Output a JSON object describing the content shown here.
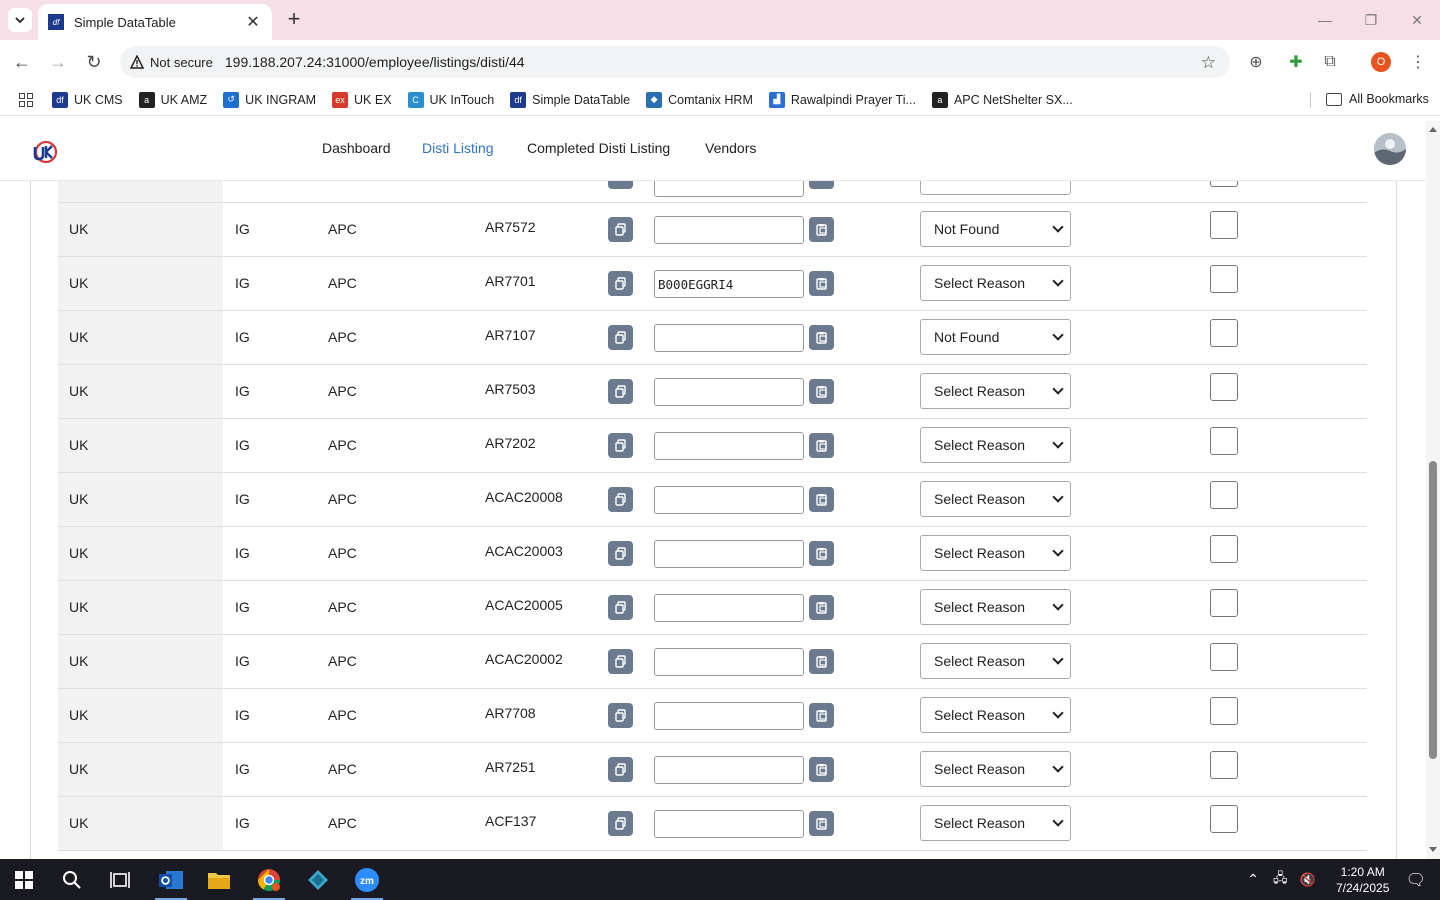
{
  "browser": {
    "tab_title": "Simple DataTable",
    "tab_favicon": "df",
    "security_label": "Not secure",
    "url": "199.188.207.24:31000/employee/listings/disti/44",
    "profile_initial": "O"
  },
  "bookmarks": [
    {
      "label": "UK CMS",
      "icon": "df",
      "color": "#1c3b8f"
    },
    {
      "label": "UK AMZ",
      "icon": "a",
      "color": "#222222"
    },
    {
      "label": "UK INGRAM",
      "icon": "↺",
      "color": "#1f6fd1"
    },
    {
      "label": "UK EX",
      "icon": "ex",
      "color": "#d83a2a"
    },
    {
      "label": "UK InTouch",
      "icon": "C",
      "color": "#2a8fd1"
    },
    {
      "label": "Simple DataTable",
      "icon": "df",
      "color": "#1c3b8f"
    },
    {
      "label": "Comtanix HRM",
      "icon": "◆",
      "color": "#2a6fb0"
    },
    {
      "label": "Rawalpindi Prayer Ti...",
      "icon": "▟",
      "color": "#2a6fd1"
    },
    {
      "label": "APC NetShelter SX...",
      "icon": "a",
      "color": "#222222"
    }
  ],
  "all_bookmarks_label": "All Bookmarks",
  "nav": {
    "links": [
      "Dashboard",
      "Disti Listing",
      "Completed Disti Listing",
      "Vendors"
    ],
    "active": "Disti Listing"
  },
  "rows": [
    {
      "country": "UK",
      "disti": "IG",
      "brand": "APC",
      "sku": "AR7572",
      "asin": "",
      "reason": "Not Found"
    },
    {
      "country": "UK",
      "disti": "IG",
      "brand": "APC",
      "sku": "AR7701",
      "asin": "B000EGGRI4",
      "reason": "Select Reason"
    },
    {
      "country": "UK",
      "disti": "IG",
      "brand": "APC",
      "sku": "AR7107",
      "asin": "",
      "reason": "Not Found"
    },
    {
      "country": "UK",
      "disti": "IG",
      "brand": "APC",
      "sku": "AR7503",
      "asin": "",
      "reason": "Select Reason"
    },
    {
      "country": "UK",
      "disti": "IG",
      "brand": "APC",
      "sku": "AR7202",
      "asin": "",
      "reason": "Select Reason"
    },
    {
      "country": "UK",
      "disti": "IG",
      "brand": "APC",
      "sku": "ACAC20008",
      "asin": "",
      "reason": "Select Reason"
    },
    {
      "country": "UK",
      "disti": "IG",
      "brand": "APC",
      "sku": "ACAC20003",
      "asin": "",
      "reason": "Select Reason"
    },
    {
      "country": "UK",
      "disti": "IG",
      "brand": "APC",
      "sku": "ACAC20005",
      "asin": "",
      "reason": "Select Reason"
    },
    {
      "country": "UK",
      "disti": "IG",
      "brand": "APC",
      "sku": "ACAC20002",
      "asin": "",
      "reason": "Select Reason"
    },
    {
      "country": "UK",
      "disti": "IG",
      "brand": "APC",
      "sku": "AR7708",
      "asin": "",
      "reason": "Select Reason"
    },
    {
      "country": "UK",
      "disti": "IG",
      "brand": "APC",
      "sku": "AR7251",
      "asin": "",
      "reason": "Select Reason"
    },
    {
      "country": "UK",
      "disti": "IG",
      "brand": "APC",
      "sku": "ACF137",
      "asin": "",
      "reason": "Select Reason"
    }
  ],
  "taskbar": {
    "time": "1:20 AM",
    "date": "7/24/2025",
    "apps": [
      "outlook-icon",
      "file-explorer-icon",
      "chrome-icon",
      "app-icon",
      "zoom-icon"
    ]
  },
  "colors": {
    "accent": "#2f73c9",
    "copy_button": "#6b7a8f",
    "tabstrip": "#f6dfe6"
  }
}
